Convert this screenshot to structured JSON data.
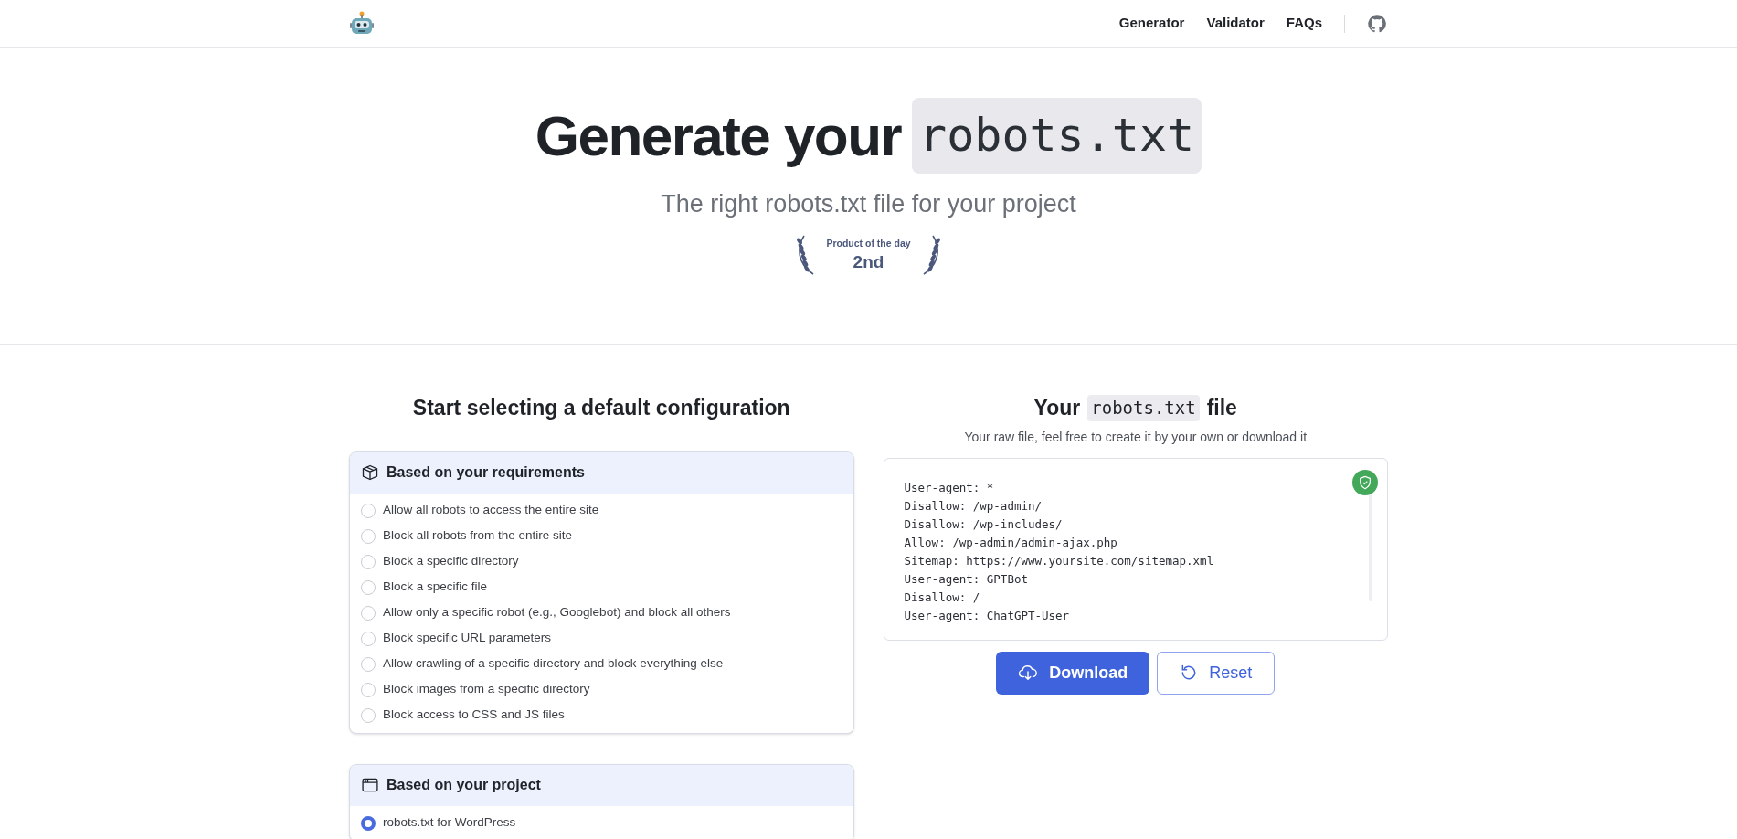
{
  "nav": {
    "links": [
      "Generator",
      "Validator",
      "FAQs"
    ]
  },
  "hero": {
    "title": "Generate your",
    "title_code": "robots.txt",
    "subtitle": "The right robots.txt file for your project",
    "badge": {
      "caption": "Product of the day",
      "rank": "2nd"
    }
  },
  "left": {
    "heading": "Start selecting a default configuration",
    "groups": [
      {
        "kind": "requirements",
        "title": "Based on your requirements",
        "options": [
          {
            "label": "Allow all robots to access the entire site",
            "selected": false
          },
          {
            "label": "Block all robots from the entire site",
            "selected": false
          },
          {
            "label": "Block a specific directory",
            "selected": false
          },
          {
            "label": "Block a specific file",
            "selected": false
          },
          {
            "label": "Allow only a specific robot (e.g., Googlebot) and block all others",
            "selected": false
          },
          {
            "label": "Block specific URL parameters",
            "selected": false
          },
          {
            "label": "Allow crawling of a specific directory and block everything else",
            "selected": false
          },
          {
            "label": "Block images from a specific directory",
            "selected": false
          },
          {
            "label": "Block access to CSS and JS files",
            "selected": false
          }
        ]
      },
      {
        "kind": "project",
        "title": "Based on your project",
        "options": [
          {
            "label": "robots.txt for WordPress",
            "selected": true
          }
        ]
      }
    ]
  },
  "right": {
    "heading_before": "Your",
    "heading_code": "robots.txt",
    "heading_after": "file",
    "subtitle": "Your raw file, feel free to create it by your own or download it",
    "lines": [
      "User-agent: *",
      "Disallow: /wp-admin/",
      "Disallow: /wp-includes/",
      "Allow: /wp-admin/admin-ajax.php",
      "Sitemap: https://www.yoursite.com/sitemap.xml",
      "User-agent: GPTBot",
      "Disallow: /",
      "User-agent: ChatGPT-User"
    ],
    "valid": true,
    "buttons": [
      {
        "kind": "primary",
        "label": "Download"
      },
      {
        "kind": "secondary",
        "label": "Reset"
      }
    ]
  }
}
